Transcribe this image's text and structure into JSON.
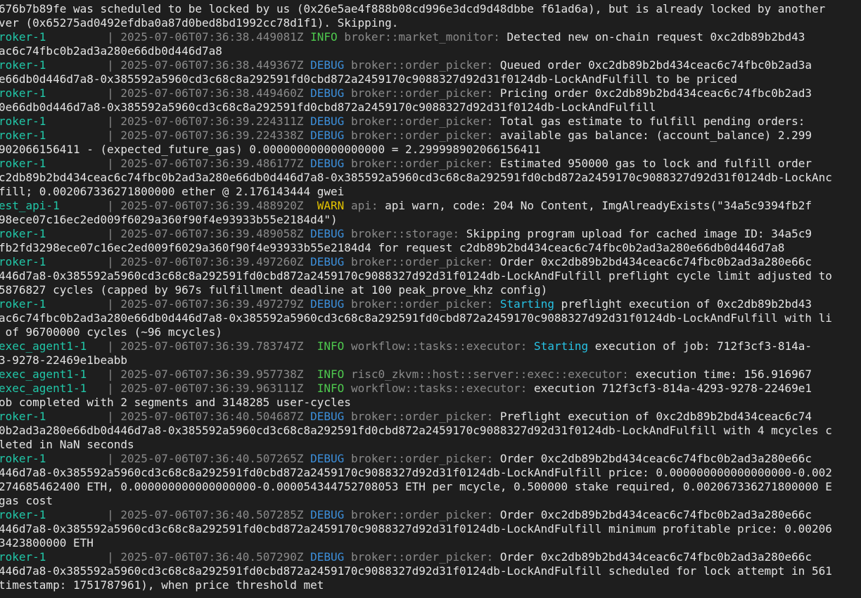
{
  "terminal": {
    "colors": {
      "background": "#1e1e1e",
      "service": "#21c7a8",
      "timestamp": "#8a8a8a",
      "info": "#4ec94e",
      "debug": "#3c8fdb",
      "warn": "#e5c400",
      "module": "#8a8a8a",
      "highlight": "#27c2e4",
      "text": "#e4e4e4"
    },
    "lines": [
      {
        "kind": "cont",
        "text": "676b7b89fe was scheduled to be locked by us (0x26e5ae4f888b08cd996e3dcd9d48dbbe f61ad6a), but is already locked by another"
      },
      {
        "kind": "cont",
        "text": "ver (0x65275ad0492efdba0a87d0bed8bd1992cc78d1f1). Skipping."
      },
      {
        "kind": "log",
        "svc": "roker-1",
        "pad": "         ",
        "ts": "2025-07-06T07:36:38.449081Z",
        "level": "INFO",
        "lvlkind": "info",
        "mod": "broker::market_monitor:",
        "msg": "Detected new on-chain request 0xc2db89b2bd43"
      },
      {
        "kind": "cont",
        "text": "ac6c74fbc0b2ad3a280e66db0d446d7a8"
      },
      {
        "kind": "log",
        "svc": "roker-1",
        "pad": "         ",
        "ts": "2025-07-06T07:36:38.449367Z",
        "level": "DEBUG",
        "lvlkind": "debug",
        "mod": "broker::order_picker:",
        "msg": "Queued order 0xc2db89b2bd434ceac6c74fbc0b2ad3a"
      },
      {
        "kind": "cont",
        "text": "e66db0d446d7a8-0x385592a5960cd3c68c8a292591fd0cbd872a2459170c9088327d92d31f0124db-LockAndFulfill to be priced"
      },
      {
        "kind": "log",
        "svc": "roker-1",
        "pad": "         ",
        "ts": "2025-07-06T07:36:38.449460Z",
        "level": "DEBUG",
        "lvlkind": "debug",
        "mod": "broker::order_picker:",
        "msg": "Pricing order 0xc2db89b2bd434ceac6c74fbc0b2ad3"
      },
      {
        "kind": "cont",
        "text": "0e66db0d446d7a8-0x385592a5960cd3c68c8a292591fd0cbd872a2459170c9088327d92d31f0124db-LockAndFulfill"
      },
      {
        "kind": "log",
        "svc": "roker-1",
        "pad": "         ",
        "ts": "2025-07-06T07:36:39.224311Z",
        "level": "DEBUG",
        "lvlkind": "debug",
        "mod": "broker::order_picker:",
        "msg": "Total gas estimate to fulfill pending orders:"
      },
      {
        "kind": "log",
        "svc": "roker-1",
        "pad": "         ",
        "ts": "2025-07-06T07:36:39.224338Z",
        "level": "DEBUG",
        "lvlkind": "debug",
        "mod": "broker::order_picker:",
        "msg": "available gas balance: (account_balance) 2.299"
      },
      {
        "kind": "cont",
        "text": "902066156411 - (expected_future_gas) 0.000000000000000000 = 2.299998902066156411"
      },
      {
        "kind": "log",
        "svc": "roker-1",
        "pad": "         ",
        "ts": "2025-07-06T07:36:39.486177Z",
        "level": "DEBUG",
        "lvlkind": "debug",
        "mod": "broker::order_picker:",
        "msg": "Estimated 950000 gas to lock and fulfill order"
      },
      {
        "kind": "cont",
        "text": "c2db89b2bd434ceac6c74fbc0b2ad3a280e66db0d446d7a8-0x385592a5960cd3c68c8a292591fd0cbd872a2459170c9088327d92d31f0124db-LockAnc"
      },
      {
        "kind": "cont",
        "text": "fill; 0.002067336271800000 ether @ 2.176143444 gwei"
      },
      {
        "kind": "log",
        "svc": "est_api-1",
        "pad": "       ",
        "ts": "2025-07-06T07:36:39.488920Z",
        "level": " WARN",
        "lvlkind": "warn",
        "mod": "api:",
        "msg": "api warn, code: 204 No Content, ImgAlreadyExists(\"34a5c9394fb2f"
      },
      {
        "kind": "cont",
        "text": "98ece07c16ec2ed009f6029a360f90f4e93933b55e2184d4\")"
      },
      {
        "kind": "log",
        "svc": "roker-1",
        "pad": "         ",
        "ts": "2025-07-06T07:36:39.489058Z",
        "level": "DEBUG",
        "lvlkind": "debug",
        "mod": "broker::storage:",
        "msg": "Skipping program upload for cached image ID: 34a5c9"
      },
      {
        "kind": "cont",
        "text": "fb2fd3298ece07c16ec2ed009f6029a360f90f4e93933b55e2184d4 for request c2db89b2bd434ceac6c74fbc0b2ad3a280e66db0d446d7a8"
      },
      {
        "kind": "log",
        "svc": "roker-1",
        "pad": "         ",
        "ts": "2025-07-06T07:36:39.497260Z",
        "level": "DEBUG",
        "lvlkind": "debug",
        "mod": "broker::order_picker:",
        "msg": "Order 0xc2db89b2bd434ceac6c74fbc0b2ad3a280e66c"
      },
      {
        "kind": "cont",
        "text": "446d7a8-0x385592a5960cd3c68c8a292591fd0cbd872a2459170c9088327d92d31f0124db-LockAndFulfill preflight cycle limit adjusted to"
      },
      {
        "kind": "cont",
        "text": "5876827 cycles (capped by 967s fulfillment deadline at 100 peak_prove_khz config)"
      },
      {
        "kind": "log",
        "svc": "roker-1",
        "pad": "         ",
        "ts": "2025-07-06T07:36:39.497279Z",
        "level": "DEBUG",
        "lvlkind": "debug",
        "mod": "broker::order_picker:",
        "hl": "Starting",
        "msg": " preflight execution of 0xc2db89b2bd43"
      },
      {
        "kind": "cont",
        "text": "ac6c74fbc0b2ad3a280e66db0d446d7a8-0x385592a5960cd3c68c8a292591fd0cbd872a2459170c9088327d92d31f0124db-LockAndFulfill with li"
      },
      {
        "kind": "cont",
        "text": " of 96700000 cycles (~96 mcycles)"
      },
      {
        "kind": "log",
        "svc": "exec_agent1-1",
        "pad": "   ",
        "ts": "2025-07-06T07:36:39.783747Z",
        "level": " INFO",
        "lvlkind": "info",
        "mod": "workflow::tasks::executor:",
        "hl": "Starting",
        "msg": " execution of job: 712f3cf3-814a-"
      },
      {
        "kind": "cont",
        "text": "3-9278-22469e1beabb"
      },
      {
        "kind": "log",
        "svc": "exec_agent1-1",
        "pad": "   ",
        "ts": "2025-07-06T07:36:39.957738Z",
        "level": " INFO",
        "lvlkind": "info",
        "mod": "risc0_zkvm::host::server::exec::executor:",
        "msg": "execution time: 156.916967"
      },
      {
        "kind": "log",
        "svc": "exec_agent1-1",
        "pad": "   ",
        "ts": "2025-07-06T07:36:39.963111Z",
        "level": " INFO",
        "lvlkind": "info",
        "mod": "workflow::tasks::executor:",
        "msg": "execution 712f3cf3-814a-4293-9278-22469e1"
      },
      {
        "kind": "cont",
        "text": "ob completed with 2 segments and 3148285 user-cycles"
      },
      {
        "kind": "log",
        "svc": "roker-1",
        "pad": "         ",
        "ts": "2025-07-06T07:36:40.504687Z",
        "level": "DEBUG",
        "lvlkind": "debug",
        "mod": "broker::order_picker:",
        "msg": "Preflight execution of 0xc2db89b2bd434ceac6c74"
      },
      {
        "kind": "cont",
        "text": "0b2ad3a280e66db0d446d7a8-0x385592a5960cd3c68c8a292591fd0cbd872a2459170c9088327d92d31f0124db-LockAndFulfill with 4 mcycles c"
      },
      {
        "kind": "cont",
        "text": "leted in NaN seconds"
      },
      {
        "kind": "log",
        "svc": "roker-1",
        "pad": "         ",
        "ts": "2025-07-06T07:36:40.507265Z",
        "level": "DEBUG",
        "lvlkind": "debug",
        "mod": "broker::order_picker:",
        "msg": "Order 0xc2db89b2bd434ceac6c74fbc0b2ad3a280e66c"
      },
      {
        "kind": "cont",
        "text": "446d7a8-0x385592a5960cd3c68c8a292591fd0cbd872a2459170c9088327d92d31f0124db-LockAndFulfill price: 0.000000000000000000-0.002"
      },
      {
        "kind": "cont",
        "text": "274685462400 ETH, 0.000000000000000000-0.000054344752708053 ETH per mcycle, 0.500000 stake required, 0.002067336271800000 E"
      },
      {
        "kind": "cont",
        "text": "gas cost"
      },
      {
        "kind": "log",
        "svc": "roker-1",
        "pad": "         ",
        "ts": "2025-07-06T07:36:40.507285Z",
        "level": "DEBUG",
        "lvlkind": "debug",
        "mod": "broker::order_picker:",
        "msg": "Order 0xc2db89b2bd434ceac6c74fbc0b2ad3a280e66c"
      },
      {
        "kind": "cont",
        "text": "446d7a8-0x385592a5960cd3c68c8a292591fd0cbd872a2459170c9088327d92d31f0124db-LockAndFulfill minimum profitable price: 0.00206"
      },
      {
        "kind": "cont",
        "text": "3423800000 ETH"
      },
      {
        "kind": "log",
        "svc": "roker-1",
        "pad": "         ",
        "ts": "2025-07-06T07:36:40.507290Z",
        "level": "DEBUG",
        "lvlkind": "debug",
        "mod": "broker::order_picker:",
        "msg": "Order 0xc2db89b2bd434ceac6c74fbc0b2ad3a280e66c"
      },
      {
        "kind": "cont",
        "text": "446d7a8-0x385592a5960cd3c68c8a292591fd0cbd872a2459170c9088327d92d31f0124db-LockAndFulfill scheduled for lock attempt in 561"
      },
      {
        "kind": "cont",
        "text": "timestamp: 1751787961), when price threshold met"
      }
    ]
  }
}
